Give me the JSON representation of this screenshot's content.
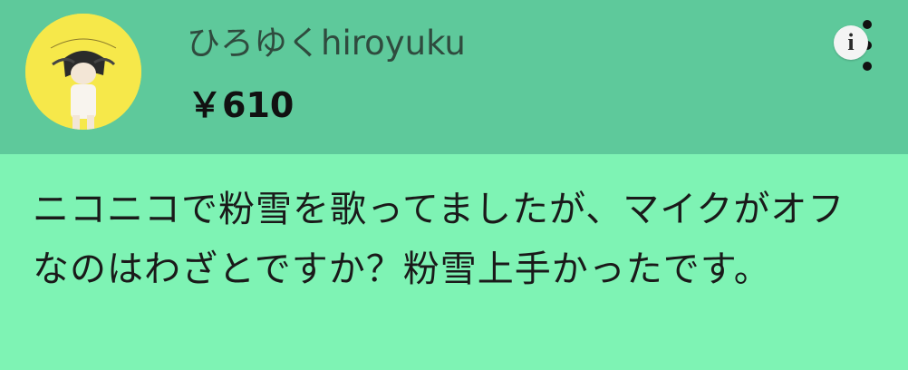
{
  "superchat": {
    "author_name": "ひろゆくhiroyuku",
    "amount": "￥610",
    "message": "ニコニコで粉雪を歌ってましたが、マイクがオフなのはわざとですか？粉雪上手かったです。",
    "avatar_text": "hiroyuku",
    "info_label": "i",
    "colors": {
      "header": "#5ec99b",
      "body": "#7ef3b4",
      "avatar_bg": "#f6e84a"
    },
    "icons": {
      "more": "more-vertical-icon",
      "info": "info-icon"
    }
  }
}
